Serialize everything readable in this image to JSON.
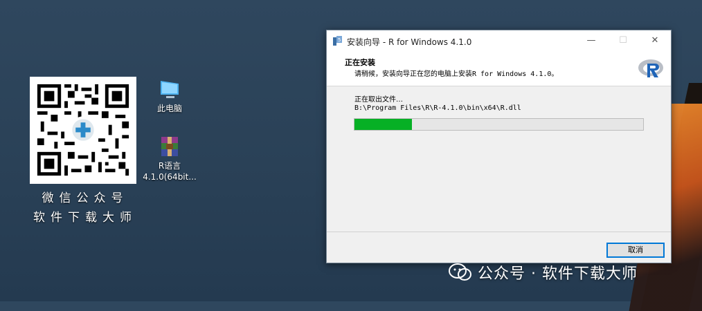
{
  "desktop": {
    "qr_caption_line1": "微信公众号",
    "qr_caption_line2": "软件下载大师",
    "icons": [
      {
        "label": "此电脑",
        "icon": "computer-icon"
      },
      {
        "label_line1": "R语言",
        "label_line2": "4.1.0(64bit...",
        "icon": "winrar-archive-icon"
      }
    ]
  },
  "installer": {
    "title": "安装向导 - R for Windows 4.1.0",
    "header_title": "正在安装",
    "header_subtitle": "请稍候，安装向导正在您的电脑上安装R for Windows 4.1.0。",
    "status_text": "正在取出文件…",
    "current_file": "B:\\Program Files\\R\\R-4.1.0\\bin\\x64\\R.dll",
    "progress_fraction": 0.2,
    "cancel_label": "取消",
    "controls": {
      "minimize": "—",
      "maximize": "☐",
      "close": "✕"
    }
  },
  "watermark": {
    "text": "公众号 · 软件下载大师"
  },
  "colors": {
    "progress": "#06b025",
    "accent": "#0078d7"
  }
}
